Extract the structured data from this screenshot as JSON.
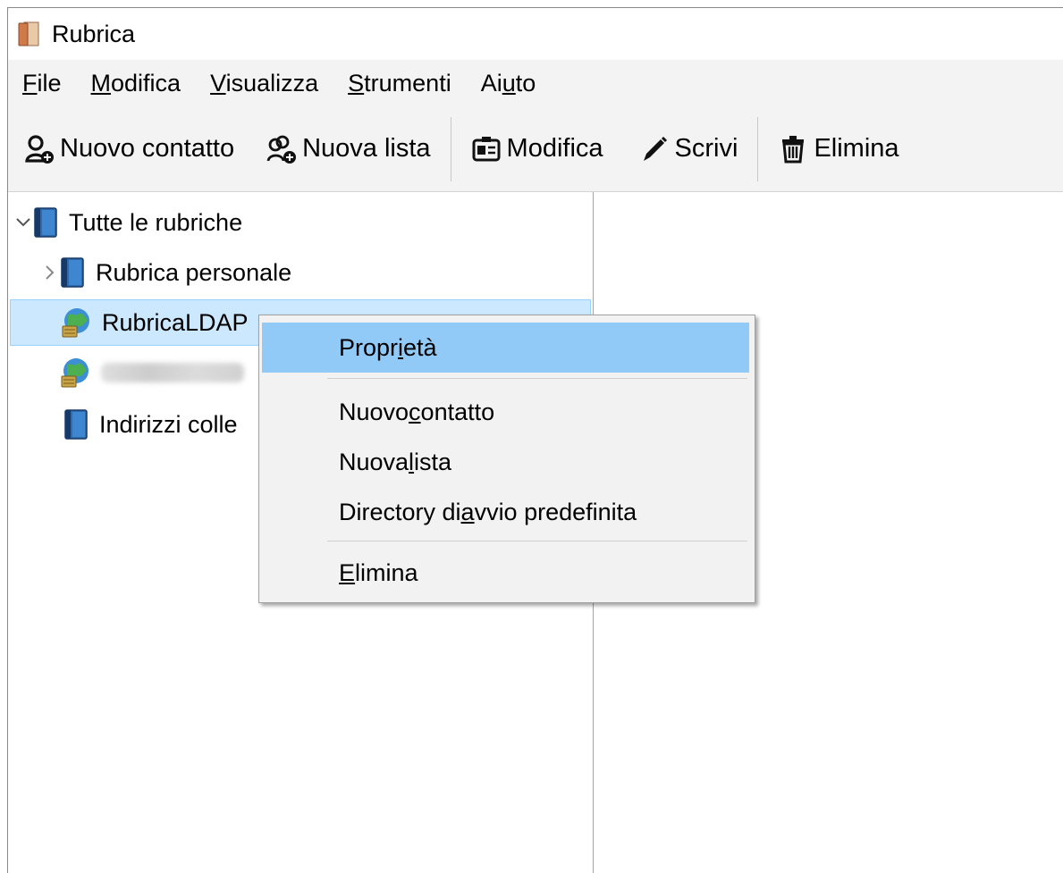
{
  "window": {
    "title": "Rubrica"
  },
  "menubar": {
    "items": [
      {
        "pre": "",
        "ul": "F",
        "post": "ile"
      },
      {
        "pre": "",
        "ul": "M",
        "post": "odifica"
      },
      {
        "pre": "",
        "ul": "V",
        "post": "isualizza"
      },
      {
        "pre": "",
        "ul": "S",
        "post": "trumenti"
      },
      {
        "pre": "Ai",
        "ul": "u",
        "post": "to"
      }
    ]
  },
  "toolbar": {
    "new_contact": "Nuovo contatto",
    "new_list": "Nuova lista",
    "edit": "Modifica",
    "write": "Scrivi",
    "delete": "Elimina"
  },
  "tree": {
    "root": "Tutte le rubriche",
    "personal": "Rubrica personale",
    "ldap": "RubricaLDAP",
    "collected": "Indirizzi colle"
  },
  "context_menu": {
    "properties": {
      "pre": "Propr",
      "ul": "i",
      "post": "età"
    },
    "new_contact": {
      "pre": "Nuovo ",
      "ul": "c",
      "post": "ontatto"
    },
    "new_list": {
      "pre": "Nuova ",
      "ul": "l",
      "post": "ista"
    },
    "default_dir": {
      "pre": "Directory di ",
      "ul": "a",
      "post": "vvio predefinita"
    },
    "delete": {
      "pre": "",
      "ul": "E",
      "post": "limina"
    }
  },
  "colors": {
    "selection_bg": "#cce8ff",
    "menu_hover": "#91c9f7",
    "menu_bg": "#f2f2f2"
  }
}
